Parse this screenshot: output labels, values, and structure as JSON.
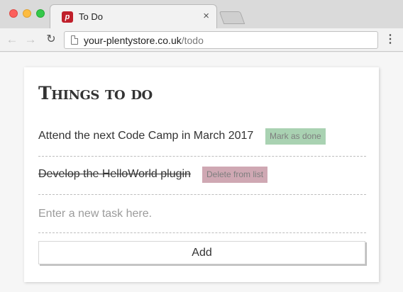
{
  "window": {
    "tab_title": "To Do",
    "tab_close": "×",
    "favicon_text": "p"
  },
  "toolbar": {
    "back_icon": "←",
    "forward_icon": "→",
    "reload_icon": "↻",
    "url_host": "your-plentystore.co.uk",
    "url_path": "/todo",
    "menu_icon": "⋮"
  },
  "app": {
    "title": "Things to do",
    "tasks": [
      {
        "text": "Attend the next Code Camp in March 2017",
        "done": false,
        "action_label": "Mark as done"
      },
      {
        "text": "Develop the HelloWorld plugin",
        "done": true,
        "action_label": "Delete from list"
      }
    ],
    "new_task_placeholder": "Enter a new task here.",
    "new_task_value": "",
    "add_label": "Add"
  },
  "colors": {
    "mark_done_bg": "#a9d2b2",
    "delete_bg": "#cfa8b3",
    "favicon_bg": "#c0202b"
  }
}
